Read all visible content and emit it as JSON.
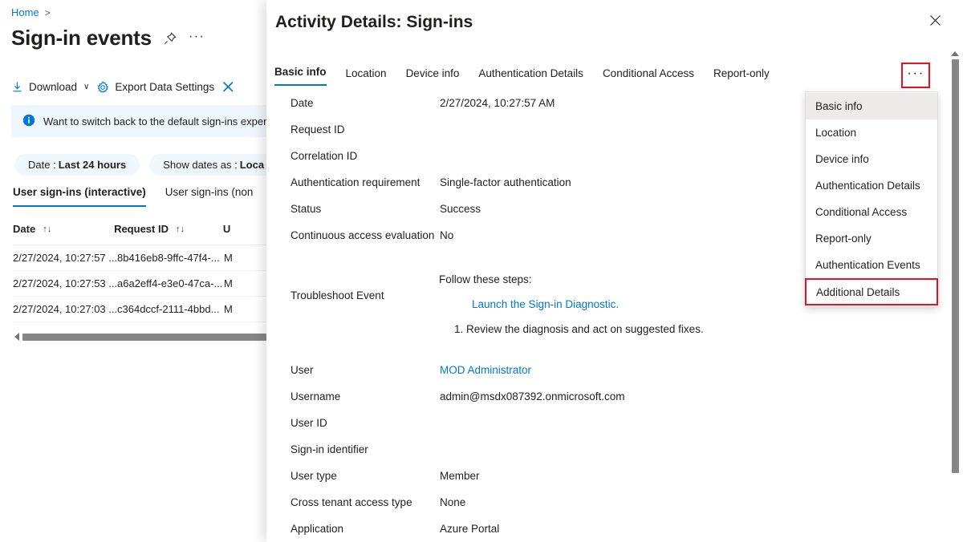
{
  "background": {
    "breadcrumb": {
      "home": "Home",
      "separator": ">"
    },
    "page_title": "Sign-in events",
    "more_label": "···",
    "command_bar": {
      "download": "Download",
      "download_chevron": "∨",
      "export_data_settings": "Export Data Settings"
    },
    "info_banner": "Want to switch back to the default sign-ins experi",
    "filters": [
      {
        "label": "Date :",
        "value": "Last 24 hours"
      },
      {
        "label": "Show dates as :",
        "value": "Loca"
      }
    ],
    "sub_tabs": [
      {
        "label": "User sign-ins (interactive)",
        "active": true
      },
      {
        "label": "User sign-ins (non",
        "active": false
      }
    ],
    "table": {
      "columns": [
        {
          "label": "Date",
          "sort": "↑↓"
        },
        {
          "label": "Request ID",
          "sort": "↑↓"
        },
        {
          "label": "U",
          "sort": ""
        }
      ],
      "rows": [
        {
          "date": "2/27/2024, 10:27:57 ...",
          "request_id": "8b416eb8-9ffc-47f4-...",
          "user": "M"
        },
        {
          "date": "2/27/2024, 10:27:53 ...",
          "request_id": "a6a2eff4-e3e0-47ca-...",
          "user": "M"
        },
        {
          "date": "2/27/2024, 10:27:03 ...",
          "request_id": "c364dccf-2111-4bbd...",
          "user": "M"
        }
      ]
    }
  },
  "panel": {
    "title": "Activity Details: Sign-ins",
    "close_label": "✕",
    "tabs": [
      {
        "label": "Basic info",
        "active": true
      },
      {
        "label": "Location",
        "active": false
      },
      {
        "label": "Device info",
        "active": false
      },
      {
        "label": "Authentication Details",
        "active": false
      },
      {
        "label": "Conditional Access",
        "active": false
      },
      {
        "label": "Report-only",
        "active": false
      }
    ],
    "tabs_overflow_label": "···",
    "dropdown": {
      "items": [
        {
          "label": "Basic info",
          "selected": true,
          "highlighted": false
        },
        {
          "label": "Location",
          "selected": false,
          "highlighted": false
        },
        {
          "label": "Device info",
          "selected": false,
          "highlighted": false
        },
        {
          "label": "Authentication Details",
          "selected": false,
          "highlighted": false
        },
        {
          "label": "Conditional Access",
          "selected": false,
          "highlighted": false
        },
        {
          "label": "Report-only",
          "selected": false,
          "highlighted": false
        },
        {
          "label": "Authentication Events",
          "selected": false,
          "highlighted": false
        },
        {
          "label": "Additional Details",
          "selected": false,
          "highlighted": true
        }
      ]
    },
    "fields_top": [
      {
        "label": "Date",
        "value": "2/27/2024, 10:27:57 AM",
        "link": false
      },
      {
        "label": "Request ID",
        "value": "",
        "link": false
      },
      {
        "label": "Correlation ID",
        "value": "",
        "link": false
      },
      {
        "label": "Authentication requirement",
        "value": "Single-factor authentication",
        "link": false
      },
      {
        "label": "Status",
        "value": "Success",
        "link": false
      },
      {
        "label": "Continuous access evaluation",
        "value": "No",
        "link": false
      }
    ],
    "troubleshoot": {
      "label": "Troubleshoot Event",
      "intro": "Follow these steps:",
      "link": "Launch the Sign-in Diagnostic.",
      "step": "1. Review the diagnosis and act on suggested fixes."
    },
    "fields_bottom": [
      {
        "label": "User",
        "value": "MOD Administrator",
        "link": true
      },
      {
        "label": "Username",
        "value": "admin@msdx087392.onmicrosoft.com",
        "link": false
      },
      {
        "label": "User ID",
        "value": "",
        "link": false
      },
      {
        "label": "Sign-in identifier",
        "value": "",
        "link": false
      },
      {
        "label": "User type",
        "value": "Member",
        "link": false
      },
      {
        "label": "Cross tenant access type",
        "value": "None",
        "link": false
      },
      {
        "label": "Application",
        "value": "Azure Portal",
        "link": false
      }
    ]
  },
  "colors": {
    "accent": "#0078d4",
    "highlight_box": "#e81123",
    "info_bg": "#eff6fc",
    "menu_selected": "#edebe9"
  }
}
